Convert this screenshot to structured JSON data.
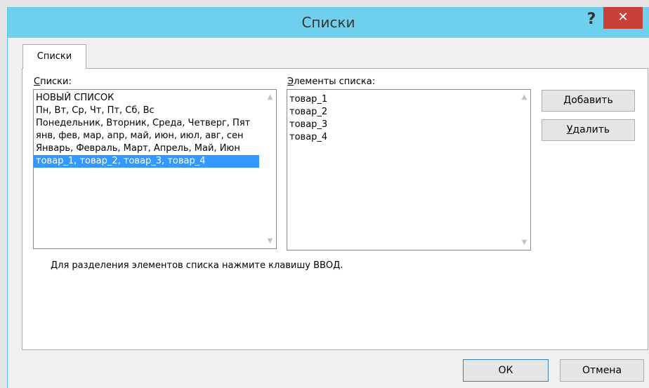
{
  "window": {
    "title": "Списки"
  },
  "titlebar": {
    "help": "?",
    "close": "✕"
  },
  "tab": {
    "label": "Списки"
  },
  "lists": {
    "label_first": "С",
    "label_rest": "писки:",
    "items": [
      "НОВЫЙ СПИСОК",
      "Пн, Вт, Ср, Чт, Пт, Сб, Вс",
      "Понедельник, Вторник, Среда, Четверг, Пят",
      "янв, фев, мар, апр, май, июн, июл, авг, сен",
      "Январь, Февраль, Март, Апрель, Май, Июн",
      "товар_1, товар_2, товар_3, товар_4"
    ],
    "selected_index": 5
  },
  "elements": {
    "label_first": "Э",
    "label_rest": "лементы списка:",
    "items": [
      "товар_1",
      "товар_2",
      "товар_3",
      "товар_4"
    ]
  },
  "buttons": {
    "add_pre": "",
    "add_u": "Д",
    "add_rest": "обавить",
    "delete_u": "У",
    "delete_rest": "далить",
    "ok": "ОК",
    "cancel": "Отмена"
  },
  "hint": "Для разделения элементов списка нажмите клавишу ВВОД."
}
